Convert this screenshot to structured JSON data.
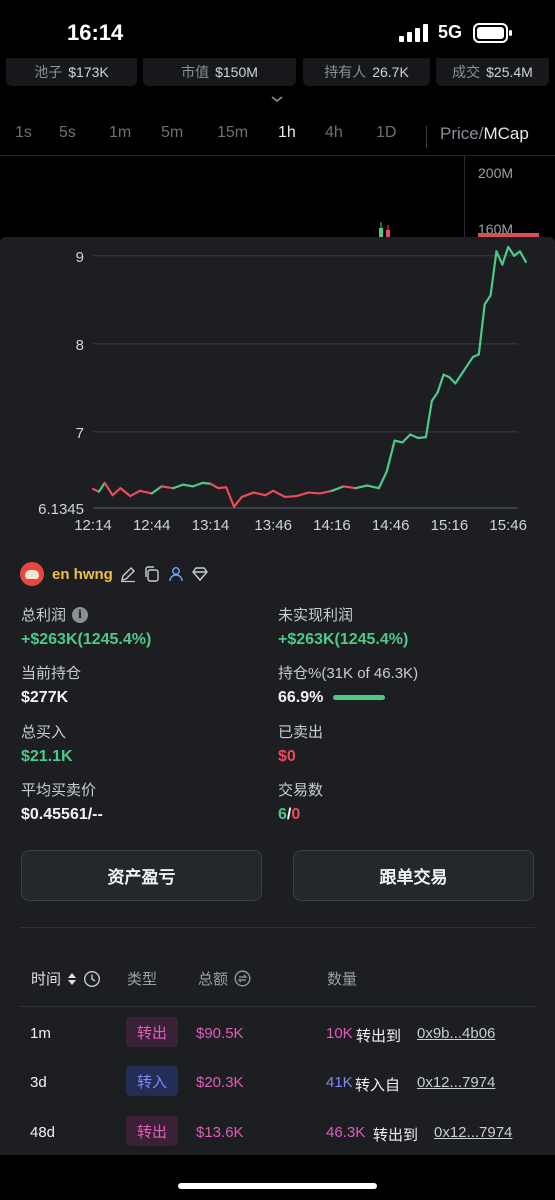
{
  "status_bar": {
    "time": "16:14",
    "network": "5G"
  },
  "stats": [
    {
      "label": "池子",
      "value": "$173K"
    },
    {
      "label": "市值",
      "value": "$150M"
    },
    {
      "label": "持有人",
      "value": "26.7K"
    },
    {
      "label": "成交",
      "value": "$25.4M"
    }
  ],
  "timeframes": [
    "1s",
    "5s",
    "1m",
    "5m",
    "15m",
    "1h",
    "4h",
    "1D"
  ],
  "active_timeframe": "1h",
  "price_toggle": {
    "left": "Price",
    "sep": "/",
    "right": "MCap"
  },
  "top_chart": {
    "axis_labels": [
      "200M",
      "160M"
    ]
  },
  "chart_data": {
    "type": "line",
    "x_ticks": [
      "12:14",
      "12:44",
      "13:14",
      "13:46",
      "14:16",
      "14:46",
      "15:16",
      "15:46"
    ],
    "y_ticks": [
      6.1345,
      7,
      8,
      9
    ],
    "ylim": [
      6.1345,
      9.1
    ],
    "series": [
      {
        "color_down": "#ea4c5a",
        "color_up": "#4dc98a",
        "points": [
          [
            "12:14",
            6.35
          ],
          [
            "12:17",
            6.32
          ],
          [
            "12:20",
            6.42
          ],
          [
            "12:24",
            6.28
          ],
          [
            "12:28",
            6.36
          ],
          [
            "12:33",
            6.27
          ],
          [
            "12:38",
            6.33
          ],
          [
            "12:44",
            6.3
          ],
          [
            "12:49",
            6.38
          ],
          [
            "12:55",
            6.36
          ],
          [
            "13:00",
            6.4
          ],
          [
            "13:05",
            6.38
          ],
          [
            "13:10",
            6.42
          ],
          [
            "13:14",
            6.41
          ],
          [
            "13:18",
            6.36
          ],
          [
            "13:22",
            6.37
          ],
          [
            "13:26",
            6.15
          ],
          [
            "13:30",
            6.26
          ],
          [
            "13:36",
            6.31
          ],
          [
            "13:42",
            6.28
          ],
          [
            "13:46",
            6.33
          ],
          [
            "13:52",
            6.26
          ],
          [
            "13:58",
            6.27
          ],
          [
            "14:04",
            6.31
          ],
          [
            "14:10",
            6.3
          ],
          [
            "14:16",
            6.33
          ],
          [
            "14:22",
            6.38
          ],
          [
            "14:28",
            6.36
          ],
          [
            "14:34",
            6.39
          ],
          [
            "14:40",
            6.36
          ],
          [
            "14:44",
            6.55
          ],
          [
            "14:48",
            6.9
          ],
          [
            "14:52",
            6.88
          ],
          [
            "14:56",
            6.97
          ],
          [
            "15:00",
            6.93
          ],
          [
            "15:04",
            6.94
          ],
          [
            "15:07",
            7.35
          ],
          [
            "15:10",
            7.45
          ],
          [
            "15:13",
            7.65
          ],
          [
            "15:16",
            7.62
          ],
          [
            "15:19",
            7.55
          ],
          [
            "15:22",
            7.65
          ],
          [
            "15:25",
            7.75
          ],
          [
            "15:28",
            7.85
          ],
          [
            "15:31",
            7.88
          ],
          [
            "15:34",
            8.45
          ],
          [
            "15:37",
            8.55
          ],
          [
            "15:40",
            9.05
          ],
          [
            "15:43",
            8.9
          ],
          [
            "15:46",
            9.1
          ],
          [
            "15:49",
            9.0
          ],
          [
            "15:52",
            9.05
          ],
          [
            "15:55",
            8.93
          ]
        ]
      }
    ]
  },
  "wallet": {
    "name": "en hwng"
  },
  "metrics": {
    "total_profit": {
      "label": "总利润",
      "value": "+$263K(1245.4%)"
    },
    "unrealized": {
      "label": "未实现利润",
      "value": "+$263K(1245.4%)"
    },
    "holding": {
      "label": "当前持仓",
      "value": "$277K"
    },
    "holding_pct": {
      "label": "持仓%(31K of 46.3K)",
      "value": "66.9%",
      "fill": 0.669
    },
    "total_buy": {
      "label": "总买入",
      "value": "$21.1K"
    },
    "sold": {
      "label": "已卖出",
      "value": "$0"
    },
    "avg_price": {
      "label": "平均买卖价",
      "value": "$0.45561/--"
    },
    "tx_count": {
      "label": "交易数",
      "buys": "6",
      "sep": "/",
      "sells": "0"
    }
  },
  "buttons": {
    "pnl": "资产盈亏",
    "copy_trade": "跟单交易"
  },
  "table": {
    "headers": {
      "time": "时间",
      "type": "类型",
      "total": "总额",
      "qty": "数量"
    },
    "rows": [
      {
        "time": "1m",
        "type": "转出",
        "kind": "out",
        "total": "$90.5K",
        "qty": "10K",
        "action": "转出到",
        "addr": "0x9b...4b06"
      },
      {
        "time": "3d",
        "type": "转入",
        "kind": "in",
        "total": "$20.3K",
        "qty": "41K",
        "action": "转入自",
        "addr": "0x12...7974"
      },
      {
        "time": "48d",
        "type": "转出",
        "kind": "out",
        "total": "$13.6K",
        "qty": "46.3K",
        "action": "转出到",
        "addr": "0x12...7974"
      }
    ]
  }
}
